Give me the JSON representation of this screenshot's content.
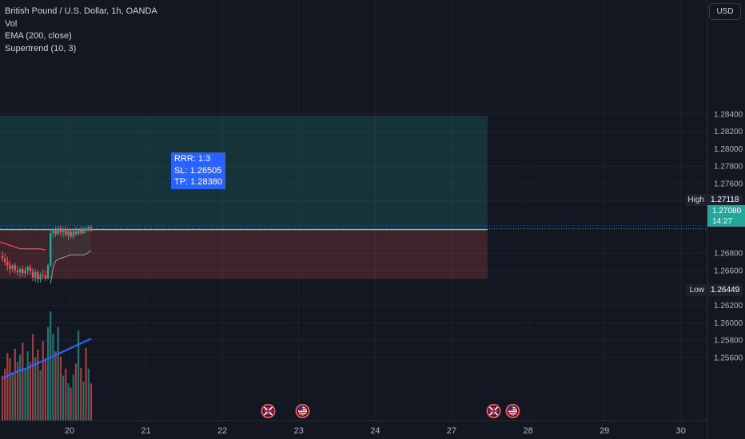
{
  "legend": {
    "symbol": "British Pound / U.S. Dollar, 1h, OANDA",
    "vol": "Vol",
    "ema": "EMA (200, close)",
    "supertrend": "Supertrend (10, 3)"
  },
  "currency_button": "USD",
  "position_box": {
    "rrr": "RRR: 1:3",
    "sl": "SL: 1.26505",
    "tp": "TP: 1.28380"
  },
  "price_tags": {
    "high_label": "High",
    "high_value": "1.27118",
    "last_value": "1.27080",
    "countdown": "14:27",
    "low_label": "Low",
    "low_value": "1.26449"
  },
  "colors": {
    "background": "#131722",
    "up": "#26a69a",
    "down": "#ef5350",
    "profit_zone": "#26a69a",
    "loss_zone": "#ef5350",
    "ema": "#2962ff",
    "supertrend": "#ef5350",
    "label_bg": "#2962ff"
  },
  "events": [
    {
      "day": 22.6,
      "flag": "GB",
      "icon": "uk-flag-icon"
    },
    {
      "day": 23.05,
      "flag": "US",
      "icon": "us-flag-icon"
    },
    {
      "day": 25.55,
      "flag": "GB",
      "icon": "uk-flag-icon"
    },
    {
      "day": 25.8,
      "flag": "US",
      "icon": "us-flag-icon"
    }
  ],
  "chart_data": {
    "type": "candlestick",
    "symbol": "GBPUSD",
    "interval": "1h",
    "y_ticks": [
      "1.28400",
      "1.28200",
      "1.28000",
      "1.27800",
      "1.27600",
      "1.27400",
      "1.26800",
      "1.26600",
      "1.26200",
      "1.26000",
      "1.25800",
      "1.25600"
    ],
    "x_ticks": [
      {
        "label": "20",
        "day": 20
      },
      {
        "label": "21",
        "day": 21
      },
      {
        "label": "22",
        "day": 22
      },
      {
        "label": "23",
        "day": 23
      },
      {
        "label": "24",
        "day": 24
      },
      {
        "label": "27",
        "day": 25
      },
      {
        "label": "28",
        "day": 26
      },
      {
        "label": "29",
        "day": 27
      },
      {
        "label": "30",
        "day": 28
      }
    ],
    "ylim": [
      1.255,
      1.2865
    ],
    "long_position": {
      "entry": 1.2707,
      "stop_loss": 1.26505,
      "take_profit": 1.2838,
      "start_day": 18.7,
      "end_day": 25.47
    },
    "high": 1.27118,
    "low": 1.26449,
    "last": 1.2708,
    "candles": [
      [
        1.2677,
        1.2682,
        1.267,
        1.2674
      ],
      [
        1.2674,
        1.268,
        1.2666,
        1.267
      ],
      [
        1.267,
        1.2676,
        1.266,
        1.2666
      ],
      [
        1.2666,
        1.2672,
        1.2656,
        1.2662
      ],
      [
        1.2662,
        1.2668,
        1.2658,
        1.2666
      ],
      [
        1.2666,
        1.2669,
        1.2657,
        1.266
      ],
      [
        1.266,
        1.2665,
        1.2654,
        1.2658
      ],
      [
        1.2658,
        1.2664,
        1.2652,
        1.2662
      ],
      [
        1.2662,
        1.2666,
        1.2653,
        1.2657
      ],
      [
        1.2657,
        1.2664,
        1.2652,
        1.266
      ],
      [
        1.266,
        1.2666,
        1.2655,
        1.2664
      ],
      [
        1.2664,
        1.2667,
        1.2655,
        1.2659
      ],
      [
        1.2659,
        1.2663,
        1.2648,
        1.2652
      ],
      [
        1.2652,
        1.2662,
        1.2647,
        1.2658
      ],
      [
        1.2658,
        1.2661,
        1.2645,
        1.265
      ],
      [
        1.265,
        1.2658,
        1.2646,
        1.2655
      ],
      [
        1.2655,
        1.2662,
        1.265,
        1.2654
      ],
      [
        1.2654,
        1.266,
        1.2648,
        1.2651
      ],
      [
        1.2651,
        1.2668,
        1.265,
        1.2666
      ],
      [
        1.2666,
        1.2707,
        1.2664,
        1.2703
      ],
      [
        1.2703,
        1.2709,
        1.2698,
        1.2706
      ],
      [
        1.2706,
        1.271,
        1.2699,
        1.2702
      ],
      [
        1.2702,
        1.2711,
        1.2701,
        1.2709
      ],
      [
        1.2709,
        1.2712,
        1.27,
        1.2704
      ],
      [
        1.2704,
        1.271,
        1.2698,
        1.2708
      ],
      [
        1.2708,
        1.2711,
        1.2699,
        1.2701
      ],
      [
        1.2701,
        1.2707,
        1.2695,
        1.2705
      ],
      [
        1.2705,
        1.2708,
        1.2697,
        1.2699
      ],
      [
        1.2699,
        1.2707,
        1.2696,
        1.2705
      ],
      [
        1.2705,
        1.271,
        1.27,
        1.2702
      ],
      [
        1.2702,
        1.2709,
        1.27,
        1.2707
      ],
      [
        1.2707,
        1.2711,
        1.2701,
        1.2703
      ],
      [
        1.2703,
        1.271,
        1.2702,
        1.2708
      ],
      [
        1.2708,
        1.2711,
        1.2703,
        1.2706
      ],
      [
        1.2706,
        1.2712,
        1.2705,
        1.271
      ],
      [
        1.271,
        1.2712,
        1.2704,
        1.2708
      ]
    ],
    "volume": [
      520,
      600,
      780,
      720,
      560,
      830,
      680,
      760,
      900,
      590,
      800,
      680,
      1000,
      730,
      820,
      580,
      920,
      700,
      1080,
      1260,
      1000,
      800,
      1080,
      740,
      520,
      600,
      430,
      380,
      530,
      660,
      1040,
      610,
      450,
      840,
      600,
      430
    ],
    "volume_max": 1280,
    "ema": [
      1.2584,
      1.2585,
      1.2586,
      1.2587,
      1.2588,
      1.2589,
      1.259,
      1.2591,
      1.25915,
      1.2592,
      1.2593,
      1.2594,
      1.2595,
      1.2596,
      1.2597,
      1.2598,
      1.2599,
      1.26,
      1.2601,
      1.2602,
      1.2603,
      1.2604,
      1.2605,
      1.2606,
      1.2607,
      1.2608,
      1.2609,
      1.261,
      1.2611,
      1.2612,
      1.2613,
      1.2614,
      1.2615,
      1.2616,
      1.2617,
      1.2618
    ],
    "supertrend_down": [
      1.2693,
      1.2692,
      1.2691,
      1.269,
      1.2689,
      1.2688,
      1.2687,
      1.2686,
      1.2685,
      1.2685,
      1.2685,
      1.2685,
      1.2685,
      1.2685,
      1.2685,
      1.2685,
      1.2685,
      1.2684,
      1.2684
    ],
    "supertrend_up": [
      1.2645,
      1.2663,
      1.2671,
      1.2673,
      1.2674,
      1.2675,
      1.2676,
      1.2677,
      1.2678,
      1.2678,
      1.2678,
      1.2678,
      1.2678,
      1.2678,
      1.2679,
      1.2681,
      1.2683
    ]
  }
}
